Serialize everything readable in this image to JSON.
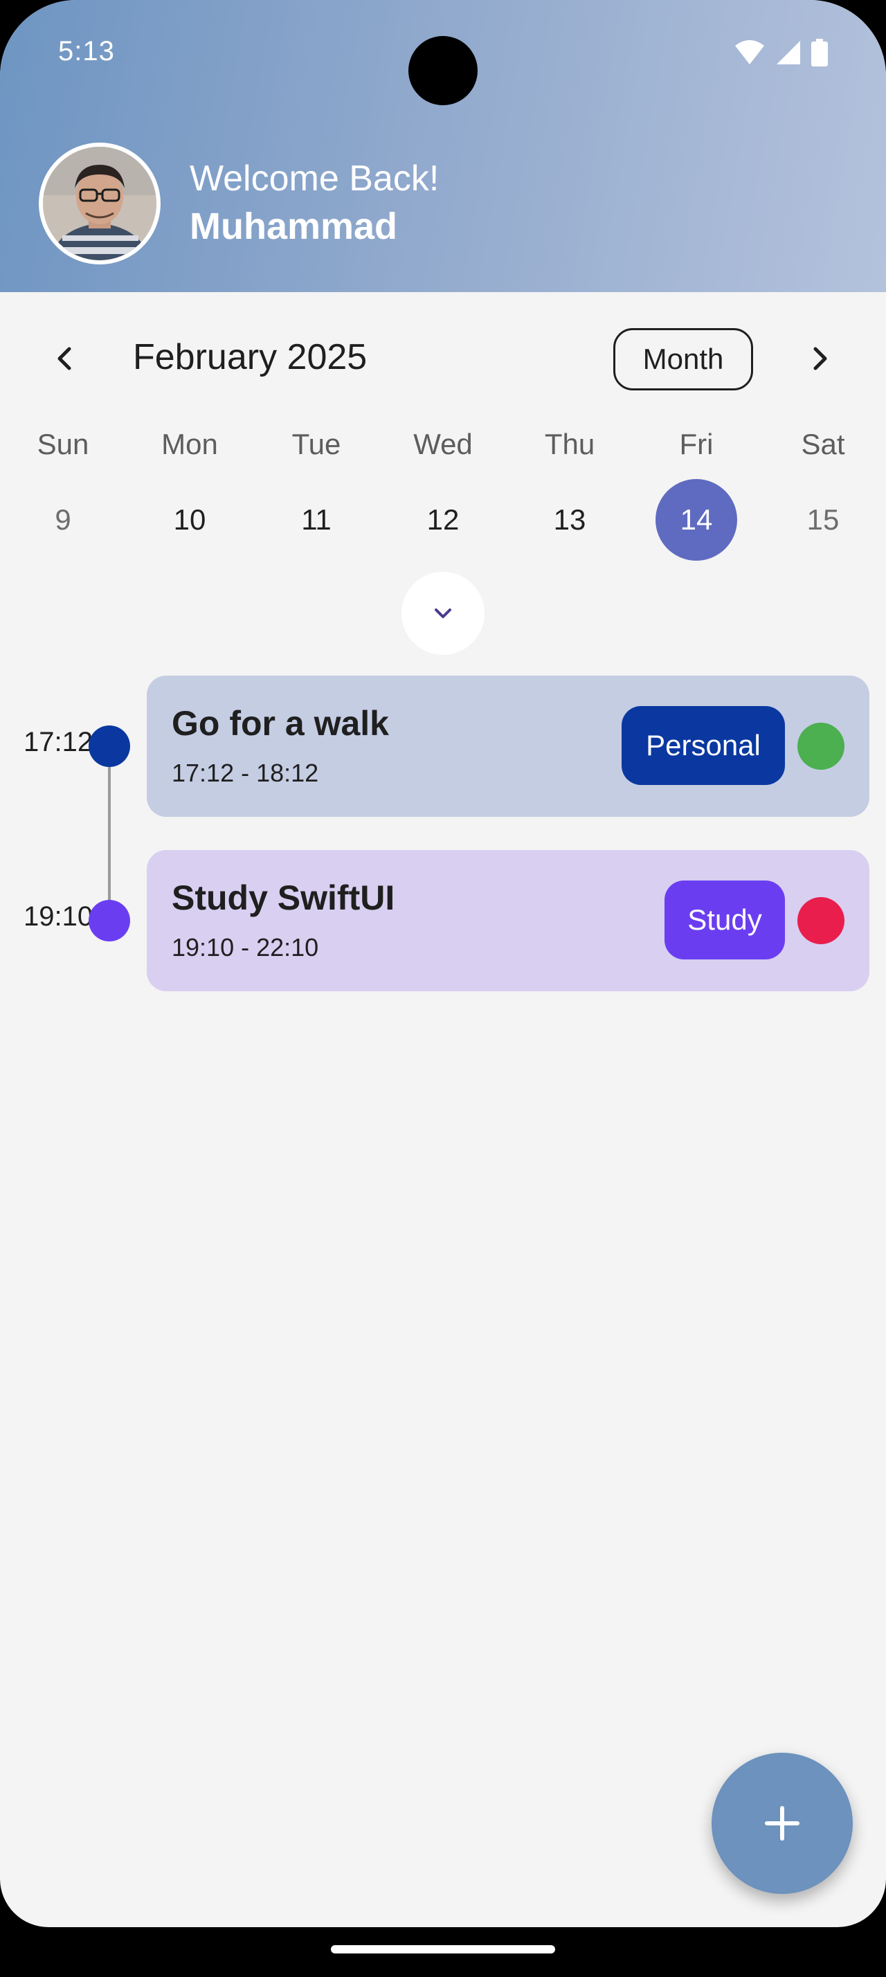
{
  "status_bar": {
    "time": "5:13",
    "icons": [
      "wifi-icon",
      "cellular-signal-icon",
      "battery-icon"
    ]
  },
  "header": {
    "greeting": "Welcome Back!",
    "username": "Muhammad",
    "avatar_icon": "user-avatar-photo"
  },
  "calendar": {
    "month_label": "February 2025",
    "view_toggle_label": "Month",
    "prev_icon": "chevron-left-icon",
    "next_icon": "chevron-right-icon",
    "expand_icon": "chevron-down-icon",
    "days": [
      {
        "dow": "Sun",
        "num": "9"
      },
      {
        "dow": "Mon",
        "num": "10"
      },
      {
        "dow": "Tue",
        "num": "11"
      },
      {
        "dow": "Wed",
        "num": "12"
      },
      {
        "dow": "Thu",
        "num": "13"
      },
      {
        "dow": "Fri",
        "num": "14"
      },
      {
        "dow": "Sat",
        "num": "15"
      }
    ],
    "selected_day": "14"
  },
  "events": [
    {
      "time_marker": "17:12",
      "title": "Go for a walk",
      "time_range": "17:12 - 18:12",
      "tag": "Personal",
      "colors": {
        "card": "#c5cde3",
        "dot": "#0a38a0",
        "tag": "#0a38a0",
        "status": "#4caf50"
      }
    },
    {
      "time_marker": "19:10",
      "title": "Study SwiftUI",
      "time_range": "19:10 - 22:10",
      "tag": "Study",
      "colors": {
        "card": "#d8cff1",
        "dot": "#6a3ef0",
        "tag": "#6a3ef0",
        "status": "#e91e4d"
      }
    }
  ],
  "fab": {
    "icon": "plus-icon"
  },
  "theme": {
    "header_gradient_start": "#6e95c2",
    "header_gradient_end": "#b4c2dc",
    "selected_day": "#5f6bc0",
    "fab": "#6c92bd",
    "background": "#f4f4f4"
  }
}
